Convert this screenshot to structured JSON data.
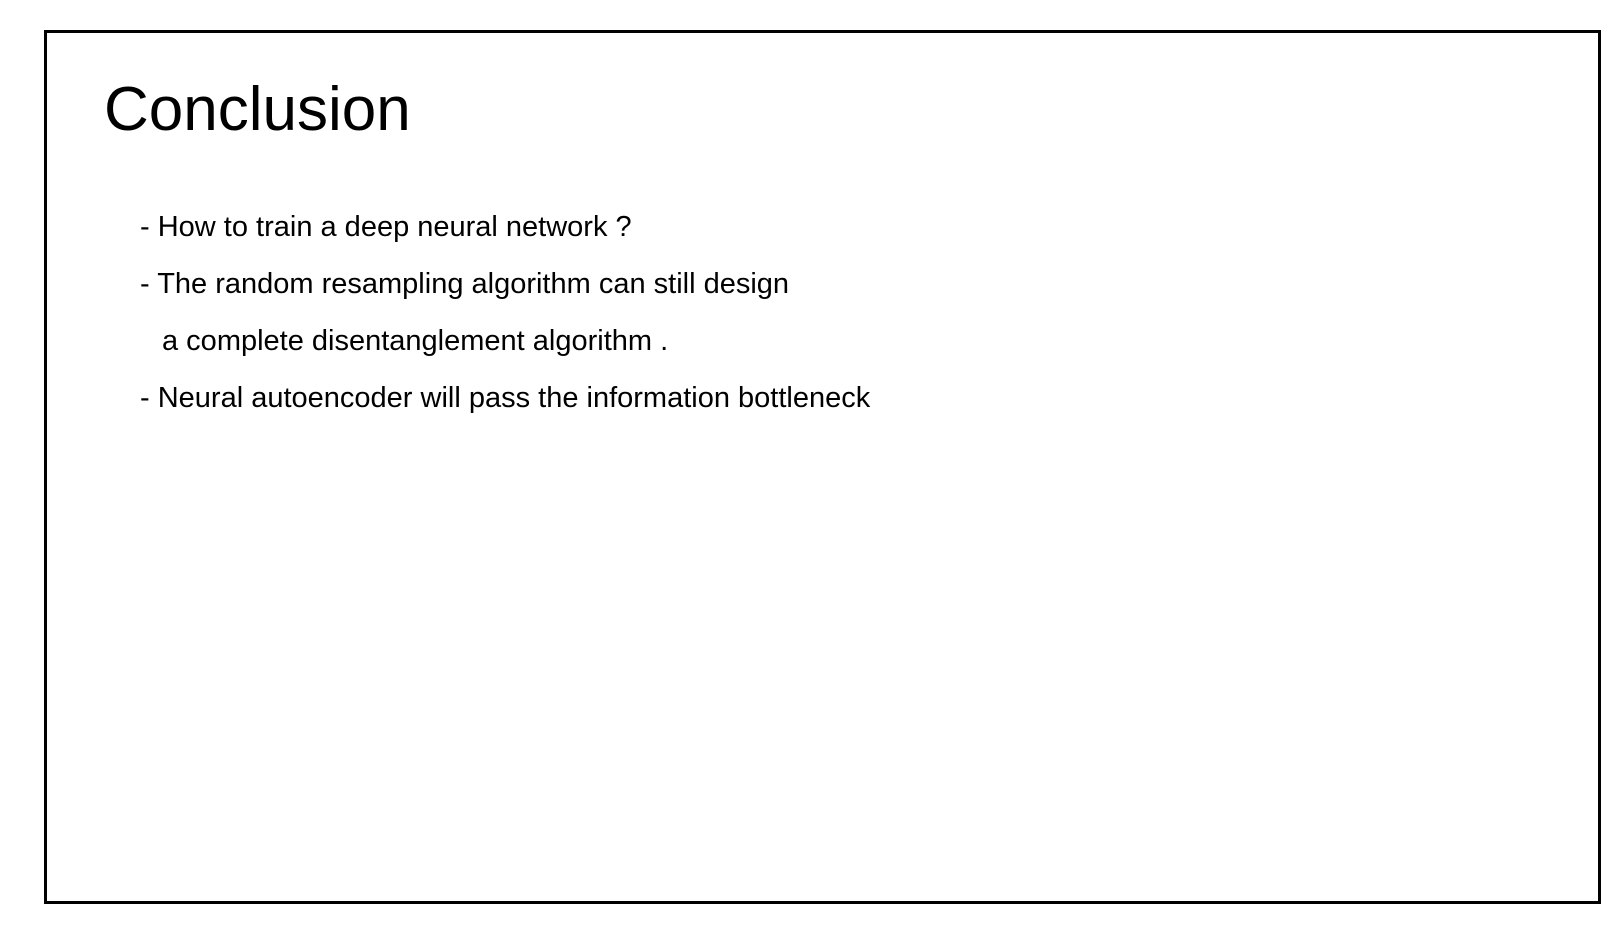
{
  "slide": {
    "title": "Conclusion",
    "lines": [
      "- How to train a deep neural network ?",
      "- The random resampling algorithm can still design",
      "a complete disentanglement algorithm .",
      "- Neural autoencoder will pass the information bottleneck"
    ]
  }
}
